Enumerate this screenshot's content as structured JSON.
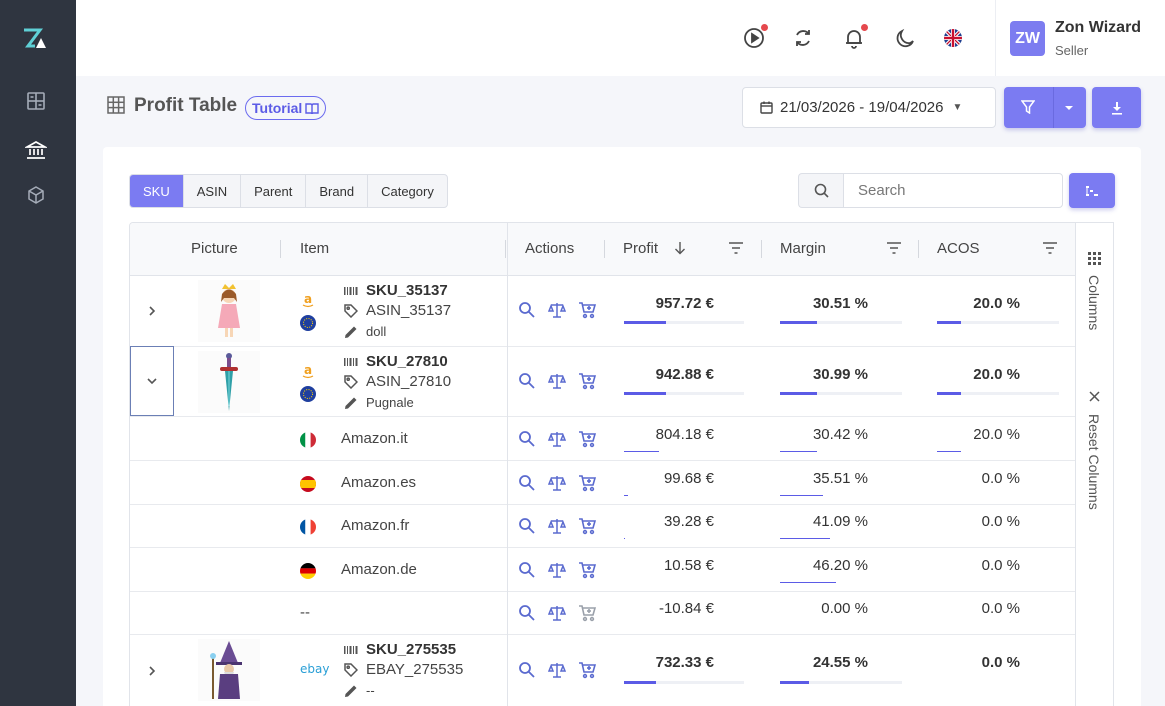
{
  "user": {
    "initials": "ZW",
    "name": "Zon Wizard",
    "role": "Seller"
  },
  "page": {
    "title": "Profit Table",
    "tutorial_label": "Tutorial"
  },
  "date_range": "21/03/2026 - 19/04/2026",
  "tabs": [
    "SKU",
    "ASIN",
    "Parent",
    "Brand",
    "Category"
  ],
  "active_tab": "SKU",
  "search": {
    "placeholder": "Search"
  },
  "columns": {
    "picture": "Picture",
    "item": "Item",
    "actions": "Actions",
    "profit": "Profit",
    "margin": "Margin",
    "acos": "ACOS"
  },
  "side_panel": {
    "columns": "Columns",
    "reset": "Reset Columns"
  },
  "rows": [
    {
      "sku": "SKU_35137",
      "asin": "ASIN_35137",
      "name": "doll",
      "profit": "957.72 €",
      "margin": "30.51 %",
      "acos": "20.0 %",
      "profit_level": 0.35,
      "margin_level": 0.3,
      "acos_level": 0.2
    },
    {
      "sku": "SKU_27810",
      "asin": "ASIN_27810",
      "name": "Pugnale",
      "profit": "942.88 €",
      "margin": "30.99 %",
      "acos": "20.0 %",
      "profit_level": 0.35,
      "margin_level": 0.3,
      "acos_level": 0.2
    },
    {
      "sku": "SKU_275535",
      "asin": "EBAY_275535",
      "name": "--",
      "profit": "732.33 €",
      "margin": "24.55 %",
      "acos": "0.0 %",
      "profit_level": 0.27,
      "margin_level": 0.24,
      "acos_level": 0.0,
      "marketplace": "ebay"
    }
  ],
  "sub_rows": [
    {
      "market": "Amazon.it",
      "profit": "804.18 €",
      "margin": "30.42 %",
      "acos": "20.0 %",
      "profit_level": 0.29,
      "margin_level": 0.3,
      "acos_level": 0.2
    },
    {
      "market": "Amazon.es",
      "profit": "99.68 €",
      "margin": "35.51 %",
      "acos": "0.0 %",
      "profit_level": 0.03,
      "margin_level": 0.35,
      "acos_level": 0.0
    },
    {
      "market": "Amazon.fr",
      "profit": "39.28 €",
      "margin": "41.09 %",
      "acos": "0.0 %",
      "profit_level": 0.01,
      "margin_level": 0.41,
      "acos_level": 0.0
    },
    {
      "market": "Amazon.de",
      "profit": "10.58 €",
      "margin": "46.20 %",
      "acos": "0.0 %",
      "profit_level": 0.0,
      "margin_level": 0.46,
      "acos_level": 0.0
    },
    {
      "market": "--",
      "profit": "-10.84 €",
      "margin": "0.00 %",
      "acos": "0.0 %",
      "profit_level": 0.0,
      "margin_level": 0.0,
      "acos_level": 0.0
    }
  ],
  "colors": {
    "accent": "#7b7bf2",
    "rail": "#2f3540",
    "action_icons": "#5a6acf"
  }
}
